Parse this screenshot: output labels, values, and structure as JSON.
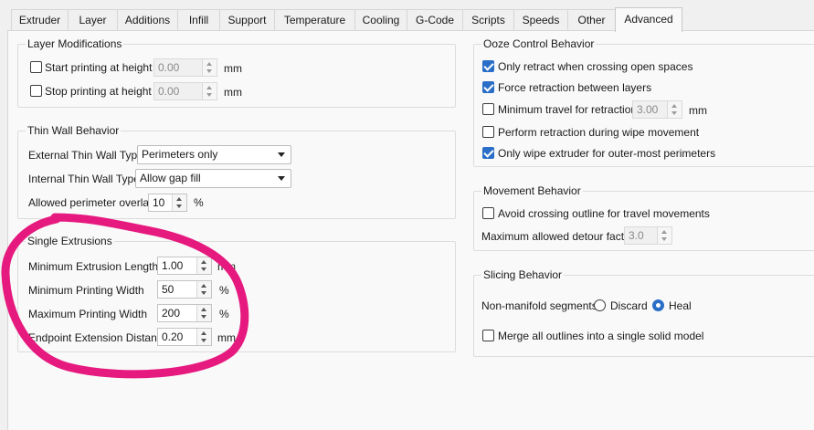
{
  "tabs": [
    "Extruder",
    "Layer",
    "Additions",
    "Infill",
    "Support",
    "Temperature",
    "Cooling",
    "G-Code",
    "Scripts",
    "Speeds",
    "Other",
    "Advanced"
  ],
  "active_tab": "Advanced",
  "layer_mod": {
    "title": "Layer Modifications",
    "start_label": "Start printing at height",
    "start_value": "0.00",
    "stop_label": "Stop printing at height",
    "stop_value": "0.00",
    "unit": "mm"
  },
  "thin_wall": {
    "title": "Thin Wall Behavior",
    "external_label": "External Thin Wall Type",
    "external_value": "Perimeters only",
    "internal_label": "Internal Thin Wall Type",
    "internal_value": "Allow gap fill",
    "overlap_label": "Allowed perimeter overlap",
    "overlap_value": "10",
    "overlap_unit": "%"
  },
  "single_ext": {
    "title": "Single Extrusions",
    "min_len_label": "Minimum Extrusion Length",
    "min_len_value": "1.00",
    "min_len_unit": "mm",
    "min_width_label": "Minimum Printing Width",
    "min_width_value": "50",
    "min_width_unit": "%",
    "max_width_label": "Maximum Printing Width",
    "max_width_value": "200",
    "max_width_unit": "%",
    "endpoint_label": "Endpoint Extension Distance",
    "endpoint_value": "0.20",
    "endpoint_unit": "mm"
  },
  "ooze": {
    "title": "Ooze Control Behavior",
    "only_retract": "Only retract when crossing open spaces",
    "force_retract": "Force retraction between layers",
    "min_travel": "Minimum travel for retraction",
    "min_travel_value": "3.00",
    "min_travel_unit": "mm",
    "wipe": "Perform retraction during wipe movement",
    "only_wipe": "Only wipe extruder for outer-most perimeters"
  },
  "movement": {
    "title": "Movement Behavior",
    "avoid": "Avoid crossing outline for travel movements",
    "detour_label": "Maximum allowed detour factor",
    "detour_value": "3.0"
  },
  "slicing": {
    "title": "Slicing Behavior",
    "nonmanifold_label": "Non-manifold segments:",
    "discard": "Discard",
    "heal": "Heal",
    "merge": "Merge all outlines into a single solid model"
  },
  "colors": {
    "accent": "#2a6ec7",
    "annotation": "#e6197f"
  }
}
